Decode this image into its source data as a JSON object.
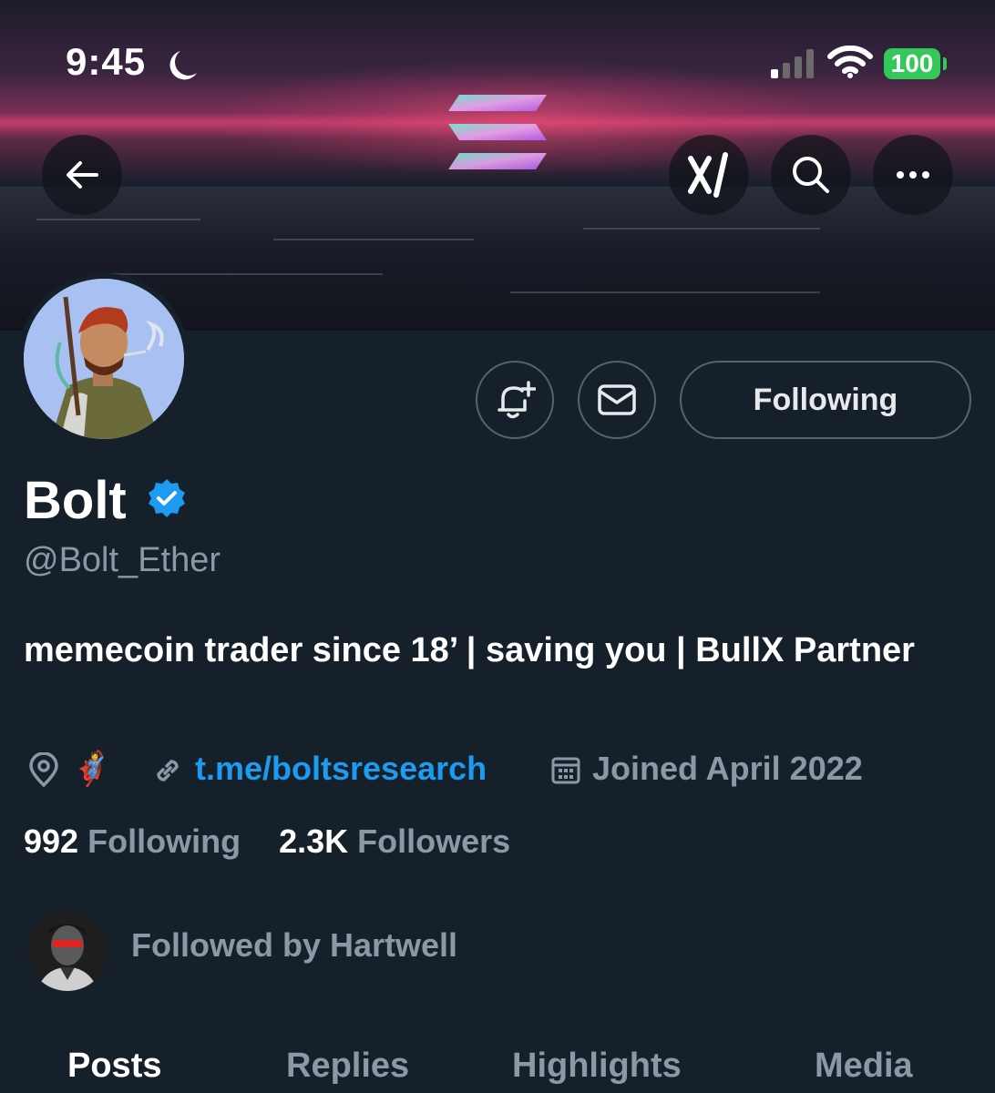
{
  "status_bar": {
    "time": "9:45",
    "battery": "100",
    "icons": [
      "moon-icon",
      "signal-icon",
      "wifi-icon",
      "battery-icon"
    ]
  },
  "header": {
    "icons": [
      "back-arrow-icon",
      "xai-grok-icon",
      "search-icon",
      "more-icon"
    ]
  },
  "profile": {
    "name": "Bolt",
    "handle": "@Bolt_Ether",
    "bio": "memecoin trader since 18’ | saving you | BullX Partner",
    "location_emoji": "🦸",
    "link": "t.me/boltsresearch",
    "joined": "Joined April 2022",
    "following_count": "992",
    "following_label": "Following",
    "followers_count": "2.3K",
    "followers_label": "Followers",
    "followed_by": "Followed by Hartwell",
    "verified_color": "#1d9bf0"
  },
  "actions": {
    "following_button": "Following",
    "icons": [
      "notification-bell-plus-icon",
      "message-envelope-icon"
    ]
  },
  "tabs": [
    {
      "label": "Posts",
      "active": true
    },
    {
      "label": "Replies",
      "active": false
    },
    {
      "label": "Highlights",
      "active": false
    },
    {
      "label": "Media",
      "active": false
    }
  ],
  "colors": {
    "background": "#15202b",
    "accent": "#1d9bf0",
    "muted_text": "#8b98a5",
    "battery": "#34c759"
  }
}
